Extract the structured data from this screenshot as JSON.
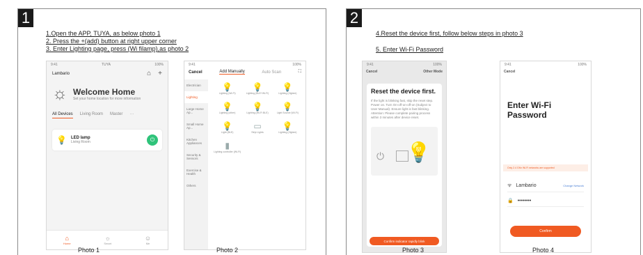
{
  "step1": {
    "number": "1",
    "instructions": [
      "1.Open the APP, TUYA, as below photo 1",
      "2. Press the +(add) button at right upper corner",
      "3. Enter Lighting page,  press (Wi filamp),as photo 2"
    ],
    "photo1_caption": "Photo 1",
    "photo2_caption": "Photo 2"
  },
  "step2": {
    "number": "2",
    "instructions": [
      "4.Reset the device first, follow below steps in photo 3",
      "5. Enter Wi-Fi Password"
    ],
    "photo3_caption": "Photo 3",
    "photo4_caption": "Photo 4"
  },
  "photo1": {
    "home_name": "Lambario",
    "welcome_title": "Welcome Home",
    "welcome_sub": "Set your home location for more information",
    "tabs": [
      "All Devices",
      "Living Room",
      "Master"
    ],
    "device_name": "LED lamp",
    "device_sub": "Living Room",
    "nav": [
      "Home",
      "Smart",
      "Me"
    ]
  },
  "photo2": {
    "cancel": "Cancel",
    "tab_manual": "Add Manually",
    "tab_auto": "Auto Scan",
    "categories": [
      "Electrician",
      "Lighting",
      "Large Home Ap...",
      "Small Home Ap...",
      "Kitchen Appliances",
      "Security & Sensors",
      "Exercise & Health",
      "Others"
    ],
    "items": [
      "Lighting (Wi-Fi)",
      "Lighting (BLE+Wi-Fi)",
      "Lighting (Zigbee)",
      "Lighting (other)",
      "Lighting (Wi-Fi BLE)",
      "Light Source (Wi-Fi)",
      "Light (BLE)",
      "Strip Lights",
      "Lighting (Zigbee)",
      "Lighting controller (Wi-Fi)"
    ]
  },
  "photo3": {
    "cancel": "Cancel",
    "other_mode": "Other Mode",
    "title": "Reset the device first.",
    "body": "If the light is blinking fast, skip the reset step. Power on. Turn On-off-on-off-on (Subject to User Manual). Ensure light is fast blinking. Attention: Please complete pairing process within 3 minutes after device reset.",
    "button": "Confirm indicator rapidly blink"
  },
  "photo4": {
    "cancel": "Cancel",
    "title": "Enter Wi-Fi Password",
    "warning": "Only 2.4 GHz Wi-Fi networks are supported",
    "ssid": "Lambario",
    "change_network": "Change Network",
    "password": "••••••••",
    "button": "Confirm"
  }
}
